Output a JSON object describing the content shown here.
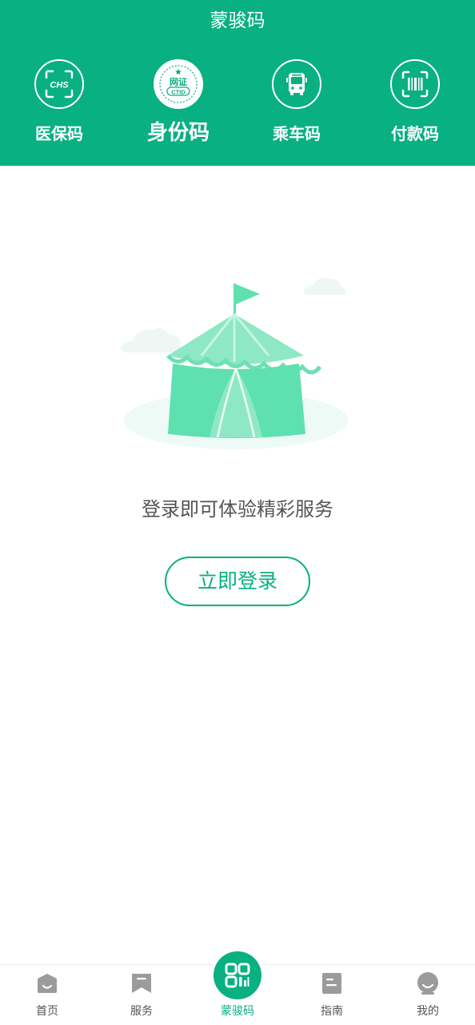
{
  "header": {
    "title": "蒙骏码",
    "background": "#08b082",
    "tabs": [
      {
        "label": "医保码",
        "icon": "chs-scan-icon",
        "icon_text": "CHS"
      },
      {
        "label": "身份码",
        "icon": "ctid-badge-icon",
        "icon_text_top": "网证",
        "icon_text_bottom": "CTID",
        "active": true
      },
      {
        "label": "乘车码",
        "icon": "bus-icon"
      },
      {
        "label": "付款码",
        "icon": "barcode-scan-icon"
      }
    ]
  },
  "empty_state": {
    "illustration": "tent-illustration",
    "message": "登录即可体验精彩服务",
    "button_label": "立即登录"
  },
  "bottom_nav": {
    "items": [
      {
        "label": "首页",
        "icon": "home-icon"
      },
      {
        "label": "服务",
        "icon": "bookmark-icon"
      },
      {
        "label": "蒙骏码",
        "icon": "qr-code-icon",
        "active": true
      },
      {
        "label": "指南",
        "icon": "guide-icon"
      },
      {
        "label": "我的",
        "icon": "profile-icon"
      }
    ]
  },
  "colors": {
    "accent": "#08b082",
    "illustration_green": "#5fe0b0",
    "nav_icon_gray": "#9b9b9b"
  }
}
